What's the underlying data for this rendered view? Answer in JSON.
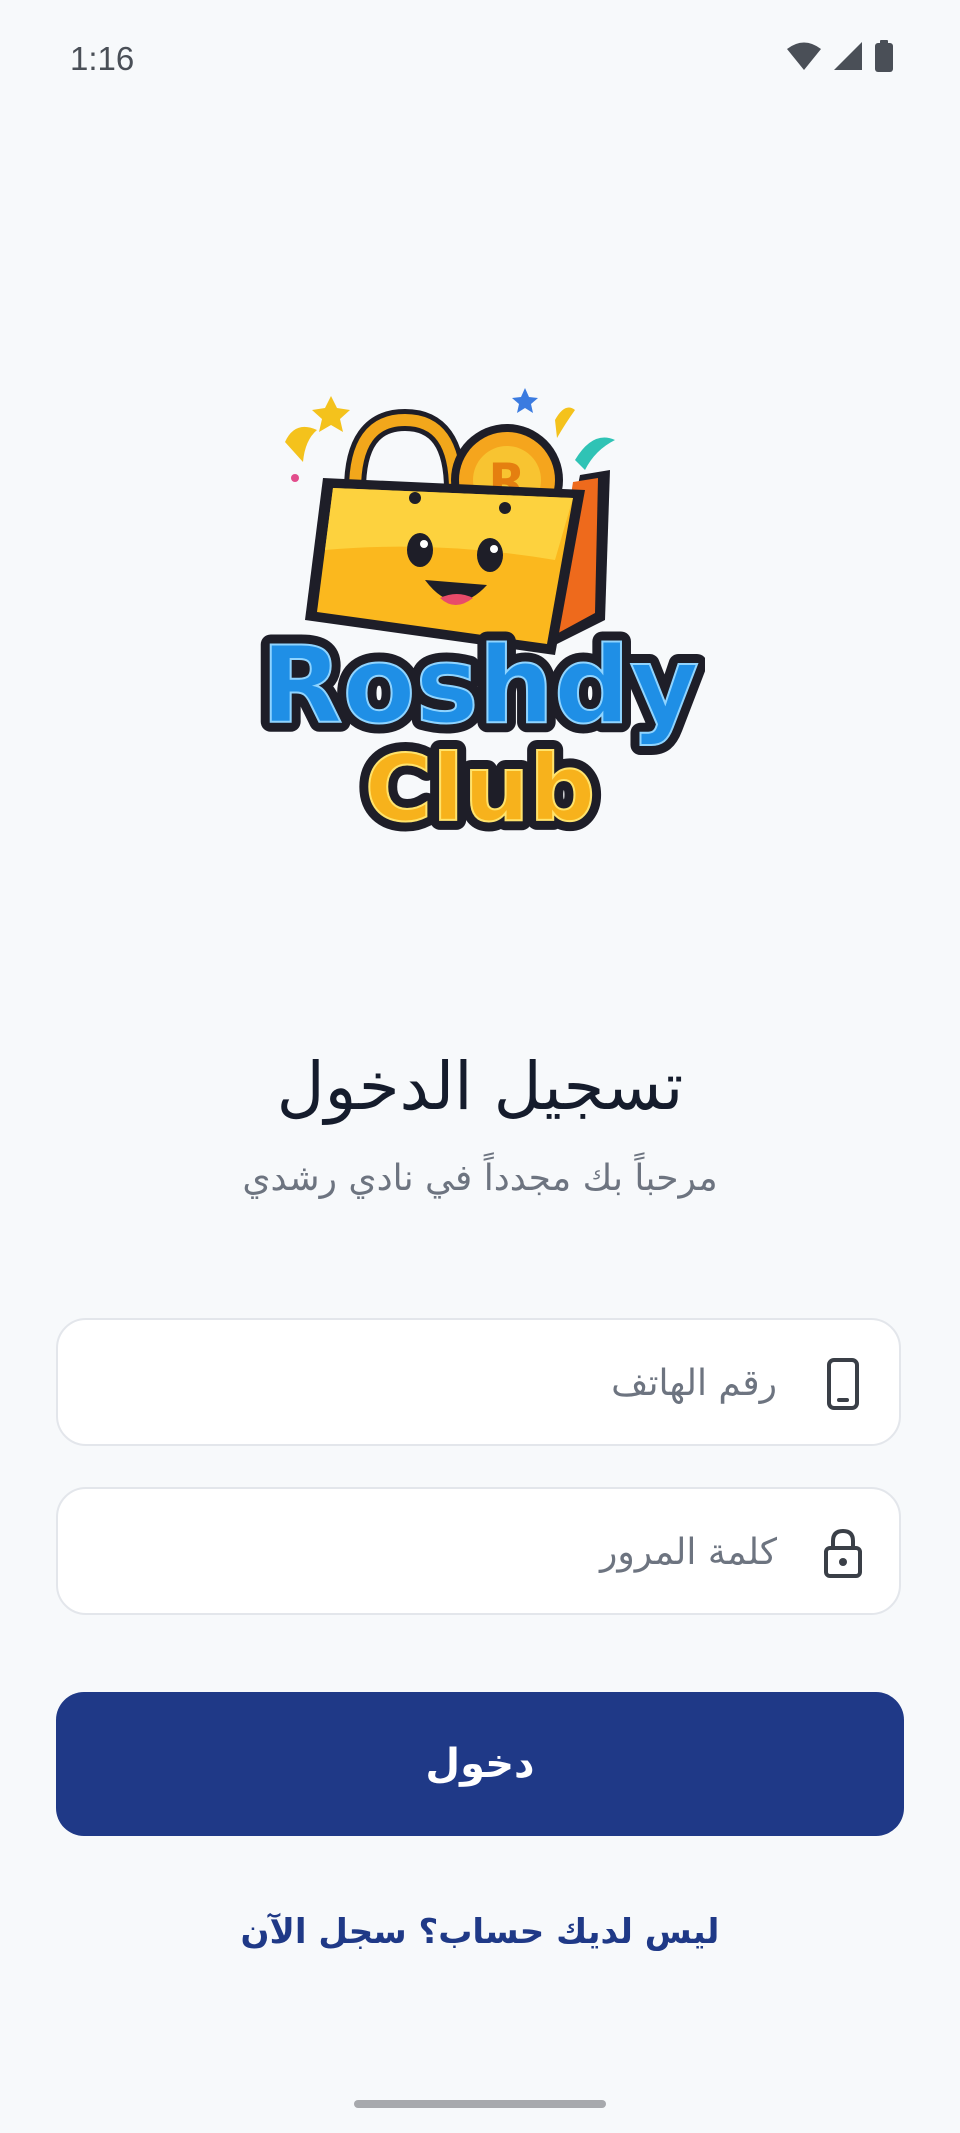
{
  "status_bar": {
    "time": "1:16",
    "icons": [
      "wifi-icon",
      "signal-icon",
      "battery-icon"
    ]
  },
  "logo": {
    "word1": "Roshdy",
    "word2": "Club",
    "coin_letter": "R"
  },
  "header": {
    "title": "تسجيل الدخول",
    "subtitle": "مرحباً بك مجدداً في نادي رشدي"
  },
  "form": {
    "phone_placeholder": "رقم الهاتف",
    "phone_value": "",
    "password_placeholder": "كلمة المرور",
    "password_value": "",
    "submit_label": "دخول"
  },
  "footer": {
    "register_link": "ليس لديك حساب؟ سجل الآن"
  },
  "colors": {
    "primary": "#1f3987",
    "background": "#f7f9fb",
    "title": "#151c2c",
    "muted": "#6d7480"
  }
}
